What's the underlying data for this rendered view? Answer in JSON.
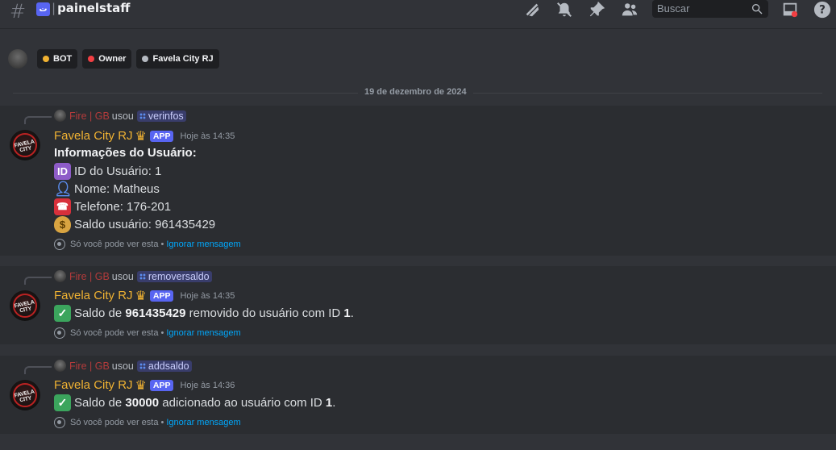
{
  "header": {
    "channel_name": "painelstaff",
    "search_placeholder": "Buscar",
    "icons": [
      "hash-icon",
      "thread-icon",
      "threads-icon",
      "mute-icon",
      "pin-icon",
      "members-icon",
      "search-icon",
      "inbox-icon",
      "help-icon"
    ]
  },
  "roles": {
    "items": [
      {
        "label": "BOT",
        "color": "#f0b232"
      },
      {
        "label": "Owner",
        "color": "#f23f43"
      },
      {
        "label": "Favela City RJ",
        "color": "#b5bac1"
      }
    ]
  },
  "divider": {
    "date": "19 de dezembro de 2024"
  },
  "messages": [
    {
      "reply_user": "Fire | GB",
      "reply_verb": "usou",
      "command": "verinfos",
      "author": "Favela City RJ",
      "badge": "APP",
      "time": "Hoje às 14:35",
      "heading": "Informações do Usuário:",
      "lines": [
        {
          "icon": "id-icon",
          "text": "ID do Usuário: 1"
        },
        {
          "icon": "user-icon",
          "text": "Nome: Matheus"
        },
        {
          "icon": "phone-icon",
          "text": "Telefone: 176-201"
        },
        {
          "icon": "money-bag-icon",
          "text": "Saldo usuário: 961435429"
        }
      ],
      "ephemeral": "Só você pode ver esta •",
      "dismiss": "Ignorar mensagem"
    },
    {
      "reply_user": "Fire | GB",
      "reply_verb": "usou",
      "command": "removersaldo",
      "author": "Favela City RJ",
      "badge": "APP",
      "time": "Hoje às 14:35",
      "text_pre": "Saldo de",
      "text_bold": "961435429",
      "text_mid": "removido do usuário com ID",
      "text_bold2": "1",
      "text_end": ".",
      "ephemeral": "Só você pode ver esta •",
      "dismiss": "Ignorar mensagem"
    },
    {
      "reply_user": "Fire | GB",
      "reply_verb": "usou",
      "command": "addsaldo",
      "author": "Favela City RJ",
      "badge": "APP",
      "time": "Hoje às 14:36",
      "text_pre": "Saldo de",
      "text_bold": "30000",
      "text_mid": "adicionado ao usuário com ID",
      "text_bold2": "1",
      "text_end": ".",
      "ephemeral": "Só você pode ver esta •",
      "dismiss": "Ignorar mensagem"
    }
  ]
}
